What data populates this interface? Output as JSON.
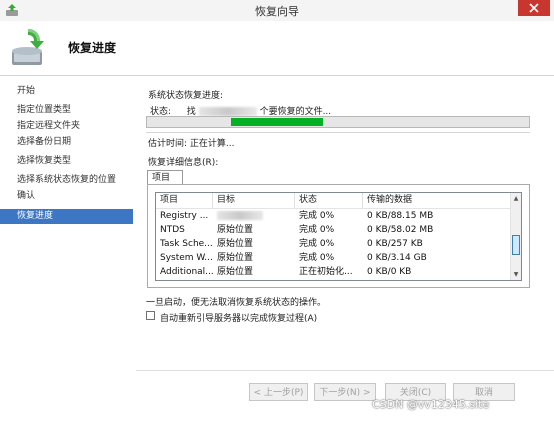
{
  "window": {
    "title": "恢复向导",
    "close_icon": "close-icon",
    "close_color": "#c7372f"
  },
  "header": {
    "title": "恢复进度",
    "icon": "restore-wizard-icon"
  },
  "sidebar": {
    "items": [
      {
        "label": "开始",
        "active": false
      },
      {
        "label": "指定位置类型",
        "active": false
      },
      {
        "label": "指定远程文件夹",
        "active": false
      },
      {
        "label": "选择备份日期",
        "active": false
      },
      {
        "label": "选择恢复类型",
        "active": false
      },
      {
        "label": "选择系统状态恢复的位置",
        "active": false
      },
      {
        "label": "确认",
        "active": false
      },
      {
        "label": "恢复进度",
        "active": true
      }
    ],
    "active_color": "#3d76c2"
  },
  "main": {
    "section_label": "系统状态恢复进度:",
    "status_prefix": "状态:",
    "status_text_start": "找",
    "status_text_end": "个要恢复的文件...",
    "progress": {
      "start_fraction": 0.22,
      "end_fraction": 0.46,
      "color": "#06b025"
    },
    "estimate": "估计时间: 正在计算...",
    "details_label": "恢复详细信息(R):",
    "tab_label": "项目",
    "columns": [
      "项目",
      "目标",
      "状态",
      "传输的数据"
    ],
    "rows": [
      [
        "Registry ...",
        "",
        "完成 0%",
        "0 KB/88.15 MB"
      ],
      [
        "NTDS",
        "原始位置",
        "完成 0%",
        "0 KB/58.02 MB"
      ],
      [
        "Task Sche...",
        "原始位置",
        "完成 0%",
        "0 KB/257 KB"
      ],
      [
        "System W...",
        "原始位置",
        "完成 0%",
        "0 KB/3.14 GB"
      ],
      [
        "Additional...",
        "原始位置",
        "正在初始化...",
        "0 KB/0 KB"
      ]
    ],
    "warning": "一旦启动，便无法取消恢复系统状态的操作。",
    "reboot_checkbox": {
      "label": "自动重新引导服务器以完成恢复过程(A)",
      "checked": false
    }
  },
  "buttons": {
    "prev": "< 上一步(P)",
    "next": "下一步(N) >",
    "close": "关闭(C)",
    "cancel": "取消"
  },
  "watermark": "CSDN @vv12345.site"
}
